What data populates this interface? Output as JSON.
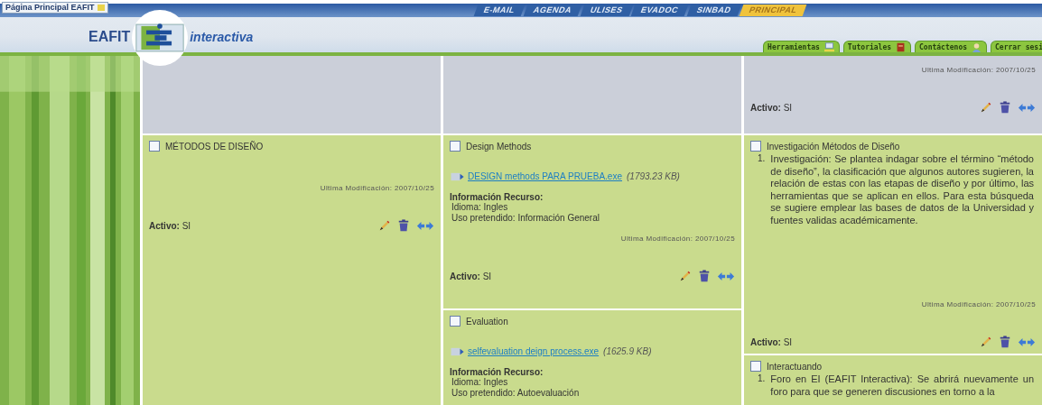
{
  "header": {
    "home_link": "Página Principal EAFIT",
    "brand": "EAFIT",
    "brand_suffix": "interactiva",
    "nav_tabs": [
      {
        "label": "E-MAIL",
        "selected": false
      },
      {
        "label": "AGENDA",
        "selected": false
      },
      {
        "label": "ULISES",
        "selected": false
      },
      {
        "label": "EVADOC",
        "selected": false
      },
      {
        "label": "SINBAD",
        "selected": false
      },
      {
        "label": "PRINCIPAL",
        "selected": true
      }
    ],
    "tool_tabs": [
      {
        "label": "Herramientas",
        "kind": "computer"
      },
      {
        "label": "Tutoriales",
        "kind": "book"
      },
      {
        "label": "Contáctenos",
        "kind": "person"
      },
      {
        "label": "Cerrar sesi"
      }
    ]
  },
  "columns": [
    {
      "cards": [
        {
          "kind": "blank"
        },
        {
          "kind": "item",
          "title": "MÉTODOS DE DISEÑO",
          "checked": false,
          "modified": "Ultima Modificación: 2007/10/25",
          "active_label": "Activo:",
          "active_value": "SI"
        }
      ]
    },
    {
      "cards": [
        {
          "kind": "blank"
        },
        {
          "kind": "item",
          "title": "Design Methods",
          "checked": false,
          "resource": {
            "file": "DESIGN methods PARA PRUEBA.exe",
            "size": "(1793.23 KB)",
            "info_heading": "Información Recurso:",
            "info_lines": [
              "Idioma: Ingles",
              "Uso pretendido: Información General"
            ]
          },
          "modified": "Ultima Modificación: 2007/10/25",
          "active_label": "Activo:",
          "active_value": "SI"
        },
        {
          "kind": "item",
          "title": "Evaluation",
          "checked": false,
          "resource": {
            "file": "selfevaluation deign process.exe",
            "size": "(1625.9 KB)",
            "info_heading": "Información Recurso:",
            "info_lines": [
              "Idioma: Ingles",
              "Uso pretendido: Autoevaluación"
            ]
          }
        }
      ]
    },
    {
      "cards": [
        {
          "kind": "footer",
          "modified": "Ultima Modificación: 2007/10/25",
          "active_label": "Activo:",
          "active_value": "SI"
        },
        {
          "kind": "item",
          "title": "Investigación Métodos de Diseño",
          "checked": false,
          "list": [
            {
              "number": "1.",
              "text": "Investigación: Se plantea indagar sobre el término “método de diseño”, la clasificación que algunos autores sugieren, la relación de estas con las etapas de diseño y por último, las herramientas que se aplican en ellos. Para esta búsqueda se sugiere emplear las bases de datos de la Universidad y fuentes validas académicamente."
            }
          ],
          "modified": "Ultima Modificación: 2007/10/25",
          "active_label": "Activo:",
          "active_value": "SI"
        },
        {
          "kind": "item",
          "title": "Interactuando",
          "checked": false,
          "list": [
            {
              "number": "1.",
              "text": "Foro en EI (EAFIT Interactiva): Se abrirá nuevamente un foro para que se generen discusiones en torno a la"
            }
          ]
        }
      ]
    }
  ]
}
